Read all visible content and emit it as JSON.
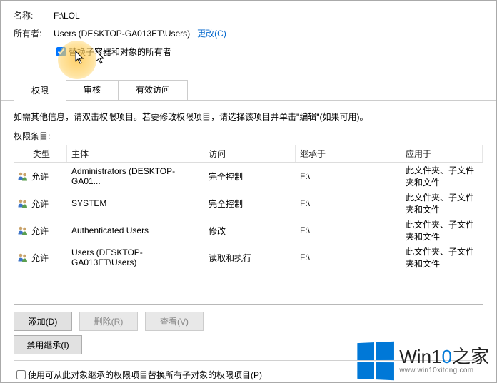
{
  "header": {
    "name_label": "名称:",
    "name_value": "F:\\LOL",
    "owner_label": "所有者:",
    "owner_value": "Users (DESKTOP-GA013ET\\Users)",
    "change_link": "更改(C)",
    "replace_owner_checkbox": "替换子容器和对象的所有者"
  },
  "tabs": [
    {
      "label": "权限",
      "active": true
    },
    {
      "label": "审核",
      "active": false
    },
    {
      "label": "有效访问",
      "active": false
    }
  ],
  "info_text": "如需其他信息，请双击权限项目。若要修改权限项目，请选择该项目并单击\"编辑\"(如果可用)。",
  "entries_label": "权限条目:",
  "columns": {
    "type": "类型",
    "principal": "主体",
    "access": "访问",
    "inherited": "继承于",
    "applies": "应用于"
  },
  "rows": [
    {
      "type": "允许",
      "principal": "Administrators (DESKTOP-GA01...",
      "access": "完全控制",
      "inherited": "F:\\",
      "applies": "此文件夹、子文件夹和文件"
    },
    {
      "type": "允许",
      "principal": "SYSTEM",
      "access": "完全控制",
      "inherited": "F:\\",
      "applies": "此文件夹、子文件夹和文件"
    },
    {
      "type": "允许",
      "principal": "Authenticated Users",
      "access": "修改",
      "inherited": "F:\\",
      "applies": "此文件夹、子文件夹和文件"
    },
    {
      "type": "允许",
      "principal": "Users (DESKTOP-GA013ET\\Users)",
      "access": "读取和执行",
      "inherited": "F:\\",
      "applies": "此文件夹、子文件夹和文件"
    }
  ],
  "buttons": {
    "add": "添加(D)",
    "remove": "删除(R)",
    "view": "查看(V)",
    "disable_inherit": "禁用继承(I)"
  },
  "bottom_checkbox": "使用可从此对象继承的权限项目替换所有子对象的权限项目(P)",
  "watermark": {
    "brand_pre": "Win1",
    "brand_accent": "0",
    "brand_post": "之家",
    "url": "www.win10xitong.com"
  }
}
